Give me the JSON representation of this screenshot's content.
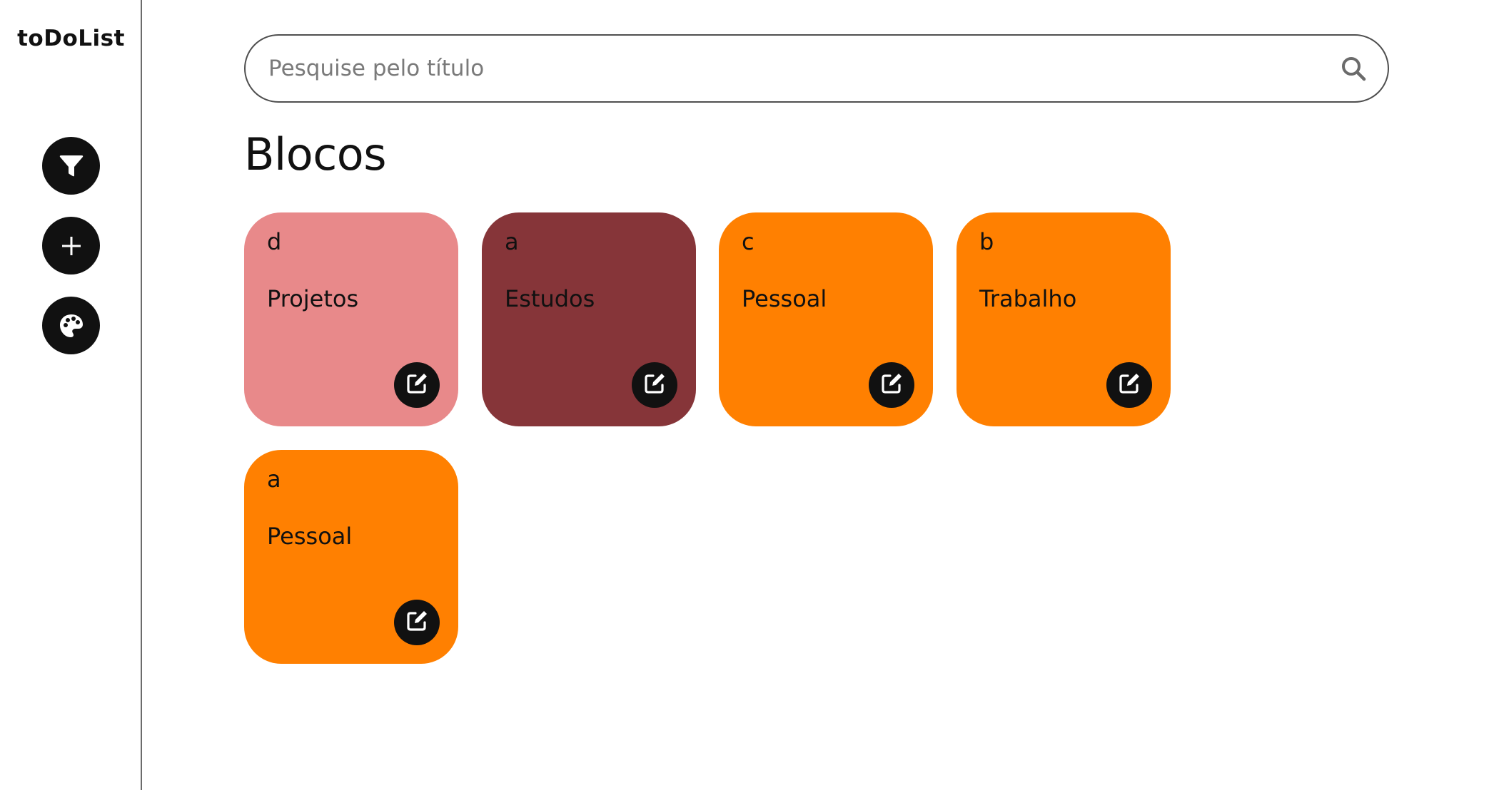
{
  "app": {
    "logo": "toDoList"
  },
  "sidebar": {
    "buttons": [
      {
        "name": "filter",
        "icon": "funnel-icon"
      },
      {
        "name": "add",
        "icon": "plus-icon"
      },
      {
        "name": "palette",
        "icon": "palette-icon"
      }
    ]
  },
  "search": {
    "placeholder": "Pesquise pelo título",
    "value": "",
    "icon": "search-icon"
  },
  "main": {
    "title": "Blocos",
    "cards": [
      {
        "letter": "d",
        "title": "Projetos",
        "color": "#e8898a"
      },
      {
        "letter": "a",
        "title": "Estudos",
        "color": "#863539"
      },
      {
        "letter": "c",
        "title": "Pessoal",
        "color": "#ff8001"
      },
      {
        "letter": "b",
        "title": "Trabalho",
        "color": "#ff8001"
      },
      {
        "letter": "a",
        "title": "Pessoal",
        "color": "#ff8001"
      }
    ]
  },
  "colors": {
    "dark": "#111111",
    "border": "#6b6b6b"
  }
}
